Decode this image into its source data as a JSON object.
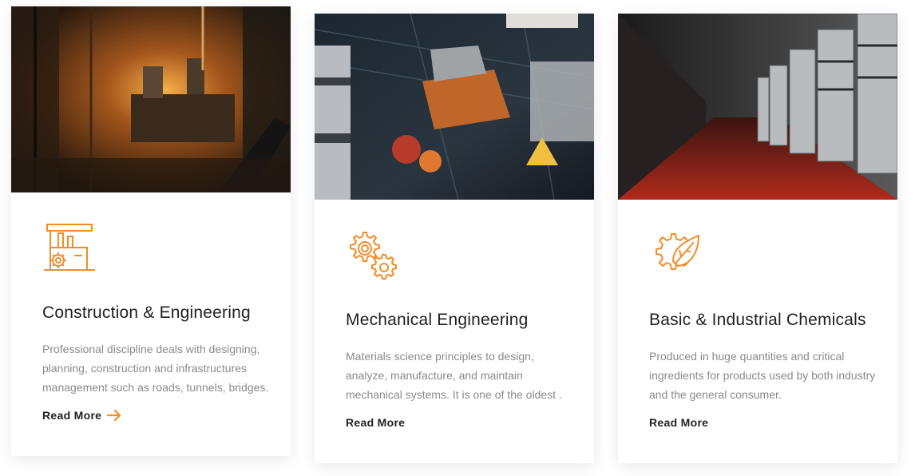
{
  "colors": {
    "accent": "#f28c28",
    "title": "#1f1f1f",
    "body_text": "#8a8a8a",
    "link": "#222222"
  },
  "cards": [
    {
      "title": "Construction & Engineering",
      "description_lines": [
        "Professional discipline deals with designing,",
        "planning, construction and infrastructures",
        "management such as roads, tunnels, bridges."
      ],
      "link_label": "Read More",
      "icon": "factory-gear-icon",
      "image": "steel-mill-photo",
      "has_arrow": true
    },
    {
      "title": "Mechanical Engineering",
      "description_lines": [
        "Materials science principles to design,",
        "analyze, manufacture, and maintain",
        "mechanical systems. It is one of the oldest ."
      ],
      "link_label": "Read More",
      "icon": "gears-icon",
      "image": "space-hangar-photo",
      "has_arrow": false
    },
    {
      "title": "Basic & Industrial Chemicals",
      "description_lines": [
        "Produced in huge quantities and critical",
        "ingredients for products used by both industry",
        "and the general consumer."
      ],
      "link_label": "Read More",
      "icon": "leaf-gear-icon",
      "image": "chemical-tanks-photo",
      "has_arrow": false
    }
  ]
}
